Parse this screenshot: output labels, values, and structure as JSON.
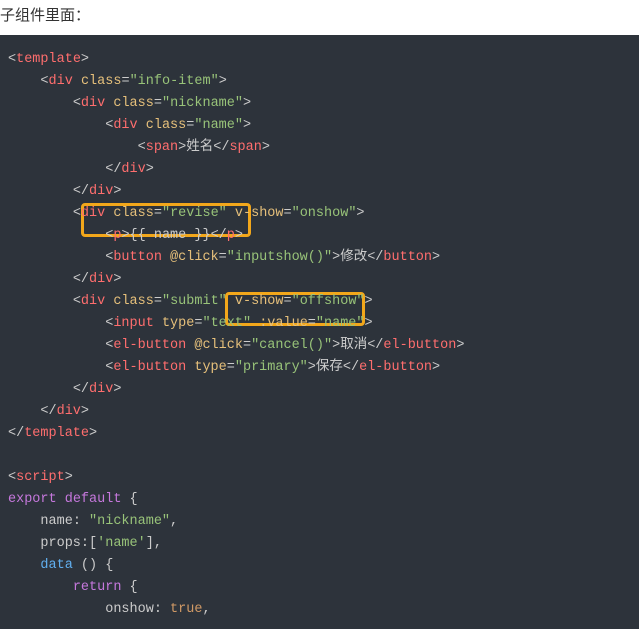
{
  "heading": "子组件里面：",
  "code": {
    "ln1_tag": "template",
    "ln2_tag": "div",
    "ln2_attr": "class",
    "ln2_val": "\"info-item\"",
    "ln3_tag": "div",
    "ln3_attr": "class",
    "ln3_val": "\"nickname\"",
    "ln4_tag": "div",
    "ln4_attr": "class",
    "ln4_val": "\"name\"",
    "ln5_tag": "span",
    "ln5_txt": "姓名",
    "ln6_tag": "div",
    "ln7_tag": "div",
    "ln8_tag": "div",
    "ln8_attr": "class",
    "ln8_val": "\"revise\"",
    "ln8_attr2": "v-show",
    "ln8_val2": "\"onshow\"",
    "ln9_tag": "p",
    "ln9_txt": "{{ name }}",
    "ln10_tag": "button",
    "ln10_attr": "@click",
    "ln10_val": "\"inputshow()\"",
    "ln10_txt": "修改",
    "ln11_tag": "div",
    "ln12_tag": "div",
    "ln12_attr": "class",
    "ln12_val": "\"submit\"",
    "ln12_attr2": "v-show",
    "ln12_val2": "\"offshow\"",
    "ln13_tag": "input",
    "ln13_attr": "type",
    "ln13_val": "\"text\"",
    "ln13_attr2": ":value",
    "ln13_val2": "\"name\"",
    "ln14_tag": "el-button",
    "ln14_attr": "@click",
    "ln14_val": "\"cancel()\"",
    "ln14_txt": "取消",
    "ln15_tag": "el-button",
    "ln15_attr": "type",
    "ln15_val": "\"primary\"",
    "ln15_txt": "保存",
    "ln16_tag": "div",
    "ln17_tag": "div",
    "ln18_tag": "template",
    "ln20_tag": "script",
    "ln21_kw1": "export",
    "ln21_kw2": "default",
    "ln22_key": "name",
    "ln22_val": "\"nickname\"",
    "ln23_key": "props",
    "ln23_val": "'name'",
    "ln24_fn": "data",
    "ln25_kw": "return",
    "ln26_key": "onshow",
    "ln26_val": "true"
  }
}
